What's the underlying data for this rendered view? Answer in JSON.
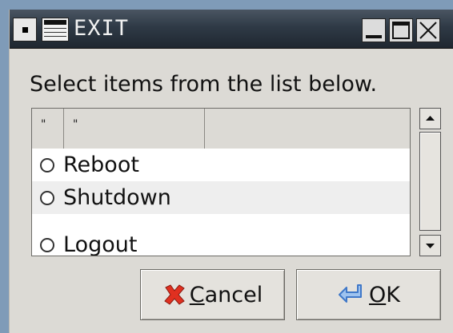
{
  "window": {
    "title": "EXIT",
    "menu_icon": "window-menu-icon",
    "app_icon": "window-icon",
    "controls": [
      "minimize-icon",
      "maximize-icon",
      "close-icon"
    ]
  },
  "prompt": "Select items from the list below.",
  "list": {
    "columns": [
      "\"",
      "\"",
      ""
    ],
    "items": [
      {
        "label": "Reboot",
        "selected": false
      },
      {
        "label": "Shutdown",
        "selected": false
      },
      {
        "label": "Logout",
        "selected": false
      }
    ]
  },
  "buttons": {
    "cancel": {
      "mnemonic": "C",
      "rest": "ancel",
      "icon": "cancel-x-icon"
    },
    "ok": {
      "mnemonic": "O",
      "rest": "K",
      "icon": "ok-arrow-icon"
    }
  },
  "colors": {
    "titlebar": "#2f3a46",
    "dialog": "#dcdad5",
    "row_alt": "#eeeeee",
    "cancel_icon": "#e03020",
    "ok_icon": "#3f78c8"
  }
}
